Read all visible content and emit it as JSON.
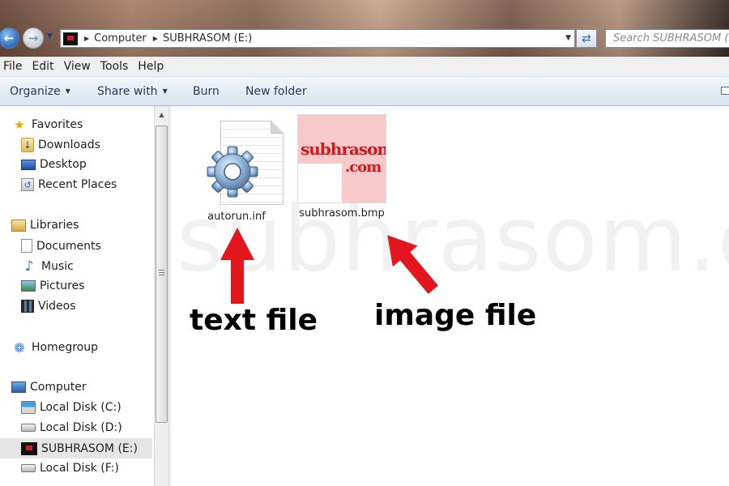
{
  "window": {
    "breadcrumb": [
      "Computer",
      "SUBHRASOM (E:)"
    ],
    "search_placeholder": "Search SUBHRASOM (E:)"
  },
  "menubar": {
    "items": [
      "File",
      "Edit",
      "View",
      "Tools",
      "Help"
    ]
  },
  "commandbar": {
    "organize": "Organize",
    "share_with": "Share with",
    "burn": "Burn",
    "new_folder": "New folder"
  },
  "navpane": {
    "favorites": {
      "label": "Favorites",
      "items": [
        "Downloads",
        "Desktop",
        "Recent Places"
      ]
    },
    "libraries": {
      "label": "Libraries",
      "items": [
        "Documents",
        "Music",
        "Pictures",
        "Videos"
      ]
    },
    "homegroup": {
      "label": "Homegroup"
    },
    "computer": {
      "label": "Computer",
      "items": [
        "Local Disk (C:)",
        "Local Disk (D:)",
        "SUBHRASOM (E:)",
        "Local Disk (F:)"
      ],
      "selected": "SUBHRASOM (E:)"
    }
  },
  "files": [
    {
      "name": "autorun.inf",
      "icon": "settings-file-icon"
    },
    {
      "name": "subhrasom.bmp",
      "icon": "bitmap-image-icon",
      "thumbnail_text": [
        "subhrasom",
        ".com"
      ]
    }
  ],
  "annotations": {
    "left": "text file",
    "right": "image file",
    "arrow_color": "#e3161d"
  },
  "watermark": "subhrasom.com",
  "colors": {
    "accent": "#2a6bbd",
    "arrow": "#e3161d",
    "selection": "#e5e5e5"
  }
}
